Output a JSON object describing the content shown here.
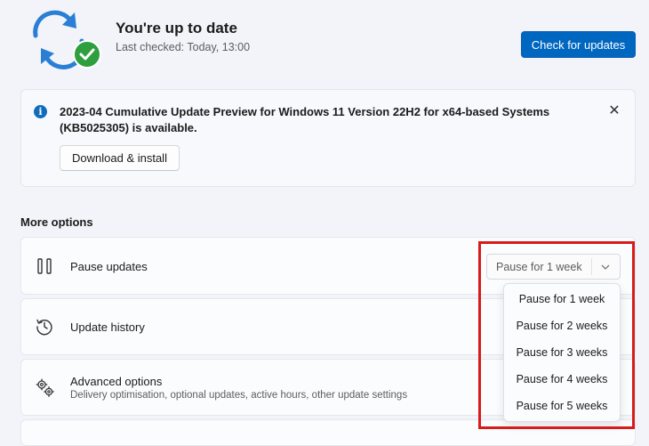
{
  "header": {
    "title": "You're up to date",
    "last_checked": "Last checked: Today, 13:00",
    "check_button": "Check for updates"
  },
  "notice": {
    "text": "2023-04 Cumulative Update Preview for Windows 11 Version 22H2 for x64-based Systems (KB5025305) is available.",
    "download_button": "Download & install",
    "info_glyph": "i",
    "close_glyph": "✕"
  },
  "more_options": {
    "label": "More options",
    "rows": [
      {
        "label": "Pause updates",
        "icon": "pause-icon"
      },
      {
        "label": "Update history",
        "icon": "history-icon"
      },
      {
        "label": "Advanced options",
        "sub": "Delivery optimisation, optional updates, active hours, other update settings",
        "icon": "gears-icon"
      }
    ]
  },
  "pause": {
    "selected": "Pause for 1 week",
    "options": [
      "Pause for 1 week",
      "Pause for 2 weeks",
      "Pause for 3 weeks",
      "Pause for 4 weeks",
      "Pause for 5 weeks"
    ]
  },
  "colors": {
    "accent": "#0067c0",
    "highlight": "#d81c1c",
    "success": "#2e9e3e"
  }
}
